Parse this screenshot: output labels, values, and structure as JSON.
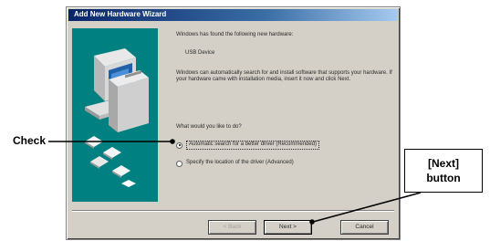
{
  "window": {
    "title": "Add New Hardware Wizard"
  },
  "content": {
    "found_text": "Windows has found the following new hardware:",
    "device_name": "USB Device",
    "auto_text": "Windows can automatically search for and install software that supports your hardware. If your hardware came with installation media, insert it now and click Next.",
    "question": "What would you like to do?",
    "options": [
      {
        "label": "Automatic search for a better driver (Recommended)",
        "selected": true
      },
      {
        "label": "Specify the location of the driver (Advanced)",
        "selected": false
      }
    ]
  },
  "buttons": {
    "back": "< Back",
    "next": "Next >",
    "cancel": "Cancel"
  },
  "annotations": {
    "check": "Check",
    "next_line1": "[Next]",
    "next_line2": "button"
  },
  "colors": {
    "dialog_face": "#d4d0c8",
    "title_bar": "#0a246a",
    "art_background": "#008080"
  }
}
